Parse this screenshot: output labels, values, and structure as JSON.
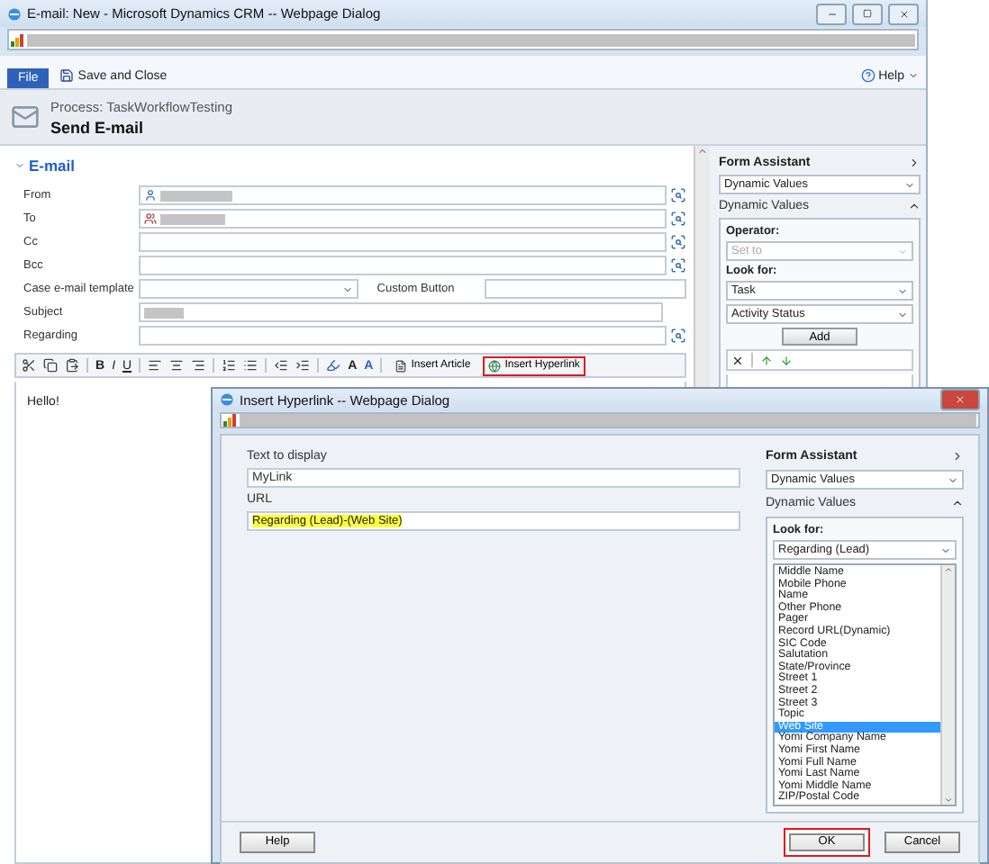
{
  "window": {
    "title": "E-mail: New - Microsoft Dynamics CRM -- Webpage Dialog"
  },
  "ribbon": {
    "file_tab": "File",
    "save": "Save and Close",
    "help": "Help"
  },
  "header": {
    "process": "Process: TaskWorkflowTesting",
    "title": "Send E-mail"
  },
  "section": {
    "title": "E-mail",
    "expanded": true
  },
  "fields": [
    {
      "kind": "lookup",
      "label": "From",
      "value_hidden": true
    },
    {
      "kind": "lookup",
      "label": "To",
      "value_hidden": true
    },
    {
      "kind": "lookup",
      "label": "Cc",
      "value_hidden": false
    },
    {
      "kind": "lookup",
      "label": "Bcc",
      "value_hidden": false
    },
    {
      "kind": "pair",
      "label": "Case e-mail template",
      "label_2": "Custom Button"
    },
    {
      "kind": "text",
      "label": "Subject",
      "value_hidden": true
    },
    {
      "kind": "lookup",
      "label": "Regarding",
      "value_hidden": false
    }
  ],
  "editor": {
    "format_buttons": [
      "B",
      "I",
      "U"
    ],
    "font_buttons": [
      "A",
      "A"
    ],
    "tools": [
      {
        "label": "Insert Article",
        "highlighted": false
      },
      {
        "label": "Insert Hyperlink",
        "highlighted": true
      }
    ],
    "body": "Hello!"
  },
  "form_assistant": {
    "title": "Form Assistant",
    "dropdown": "Dynamic Values",
    "section": "Dynamic Values",
    "operator_label": "Operator:",
    "operator": "Set to",
    "look_for_label": "Look for:",
    "look_for": "Task",
    "attribute": "Activity Status",
    "add": "Add"
  },
  "dialog": {
    "title": "Insert Hyperlink -- Webpage Dialog",
    "text_label": "Text to display",
    "text_value": "MyLink",
    "url_label": "URL",
    "url_value": "Regarding (Lead)-(Web Site)",
    "assistant": {
      "title": "Form Assistant",
      "dropdown": "Dynamic Values",
      "section": "Dynamic Values",
      "look_for_label": "Look for:",
      "look_for": "Regarding (Lead)",
      "items": [
        {
          "label": "Middle Name",
          "selected": false
        },
        {
          "label": "Mobile Phone",
          "selected": false
        },
        {
          "label": "Name",
          "selected": false
        },
        {
          "label": "Other Phone",
          "selected": false
        },
        {
          "label": "Pager",
          "selected": false
        },
        {
          "label": "Record URL(Dynamic)",
          "selected": false
        },
        {
          "label": "SIC Code",
          "selected": false
        },
        {
          "label": "Salutation",
          "selected": false
        },
        {
          "label": "State/Province",
          "selected": false
        },
        {
          "label": "Street 1",
          "selected": false
        },
        {
          "label": "Street 2",
          "selected": false
        },
        {
          "label": "Street 3",
          "selected": false
        },
        {
          "label": "Topic",
          "selected": false
        },
        {
          "label": "Web Site",
          "selected": true
        },
        {
          "label": "Yomi Company Name",
          "selected": false
        },
        {
          "label": "Yomi First Name",
          "selected": false
        },
        {
          "label": "Yomi Full Name",
          "selected": false
        },
        {
          "label": "Yomi Last Name",
          "selected": false
        },
        {
          "label": "Yomi Middle Name",
          "selected": false
        },
        {
          "label": "ZIP/Postal Code",
          "selected": false
        }
      ]
    },
    "buttons": [
      {
        "kind": "help",
        "label": "Help",
        "highlighted": false
      },
      {
        "kind": "ok",
        "label": "OK",
        "highlighted": true
      },
      {
        "kind": "cancel",
        "label": "Cancel",
        "highlighted": false
      }
    ]
  }
}
